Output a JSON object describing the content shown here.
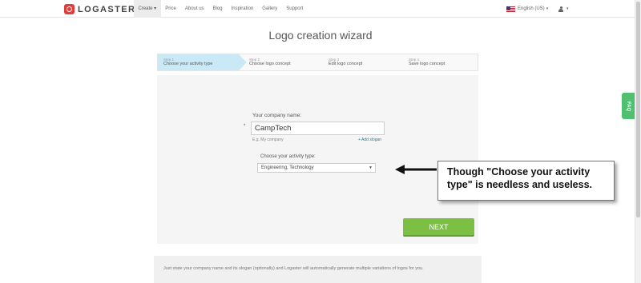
{
  "brand": {
    "logo_text": "LOGASTER"
  },
  "nav": {
    "items": [
      {
        "label": "Create ▾"
      },
      {
        "label": "Price"
      },
      {
        "label": "About us"
      },
      {
        "label": "Blog"
      },
      {
        "label": "Inspiration"
      },
      {
        "label": "Gallery"
      },
      {
        "label": "Support"
      }
    ],
    "language": "English (US)",
    "language_caret": "▾",
    "user_caret": "▾"
  },
  "page": {
    "title": "Logo creation wizard"
  },
  "steps": [
    {
      "num": "Step 1",
      "name": "Choose your activity type"
    },
    {
      "num": "Step 2",
      "name": "Choose logo concept"
    },
    {
      "num": "Step 3",
      "name": "Edit logo concept"
    },
    {
      "num": "Step 4",
      "name": "Save logo concept"
    }
  ],
  "form": {
    "company_label": "Your company name:",
    "required_mark": "*",
    "company_value": "CampTech",
    "company_hint": "E.g. My company",
    "add_slogan": "+ Add slogan",
    "activity_label": "Choose your activity type:",
    "activity_value": "Engineering, Technology",
    "next_label": "NEXT"
  },
  "annotation": {
    "text": "Though \"Choose your activity type\" is needless and useless."
  },
  "faq": {
    "label": "FAQ"
  },
  "footer": {
    "text": "Just state your company name and its slogan (optionally) and Logaster will automatically generate multiple variations of logos for you."
  },
  "colors": {
    "accent_green": "#7cc043",
    "step_active": "#c9e9f7",
    "brand_red": "#e23b3b",
    "faq_green": "#4fbf70"
  }
}
